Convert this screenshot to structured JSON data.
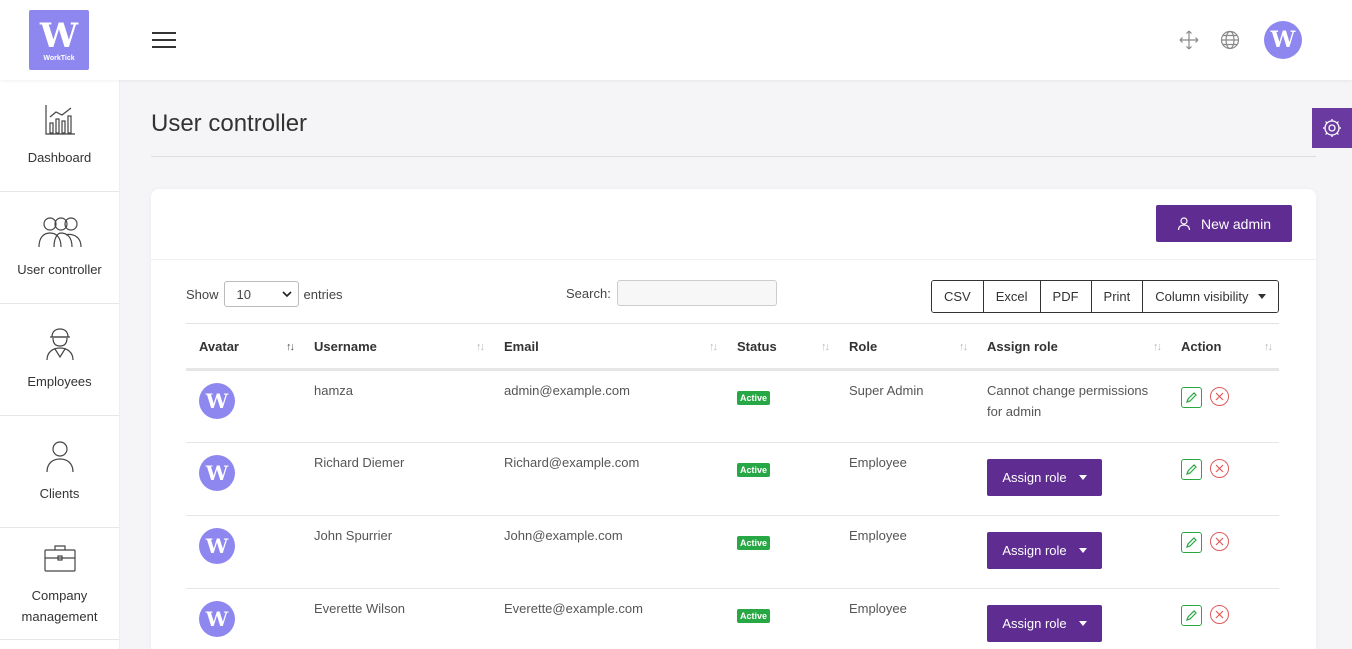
{
  "brand": {
    "logo_letter": "W",
    "logo_text": "WorkTick",
    "accent": "#5f2d91",
    "logo_bg": "#8f87f0"
  },
  "header": {
    "avatar_letter": "W"
  },
  "sidebar": {
    "items": [
      {
        "label": "Dashboard",
        "icon": "chart-icon"
      },
      {
        "label": "User controller",
        "icon": "users-icon"
      },
      {
        "label": "Employees",
        "icon": "worker-icon"
      },
      {
        "label": "Clients",
        "icon": "person-icon"
      },
      {
        "label": "Company\nmanagement",
        "icon": "briefcase-icon"
      }
    ]
  },
  "page": {
    "title": "User controller"
  },
  "toolbar": {
    "new_admin_label": "New admin",
    "show_label": "Show",
    "entries_value": "10",
    "entries_label": "entries",
    "search_label": "Search:",
    "search_value": "",
    "export_buttons": [
      "CSV",
      "Excel",
      "PDF",
      "Print",
      "Column visibility"
    ]
  },
  "table": {
    "columns": [
      "Avatar",
      "Username",
      "Email",
      "Status",
      "Role",
      "Assign role",
      "Action"
    ],
    "rows": [
      {
        "username": "hamza",
        "email": "admin@example.com",
        "status": "Active",
        "role": "Super Admin",
        "assign": "Cannot change permissions for admin"
      },
      {
        "username": "Richard Diemer",
        "email": "Richard@example.com",
        "status": "Active",
        "role": "Employee",
        "assign": "Assign role"
      },
      {
        "username": "John Spurrier",
        "email": "John@example.com",
        "status": "Active",
        "role": "Employee",
        "assign": "Assign role"
      },
      {
        "username": "Everette Wilson",
        "email": "Everette@example.com",
        "status": "Active",
        "role": "Employee",
        "assign": "Assign role"
      }
    ]
  }
}
